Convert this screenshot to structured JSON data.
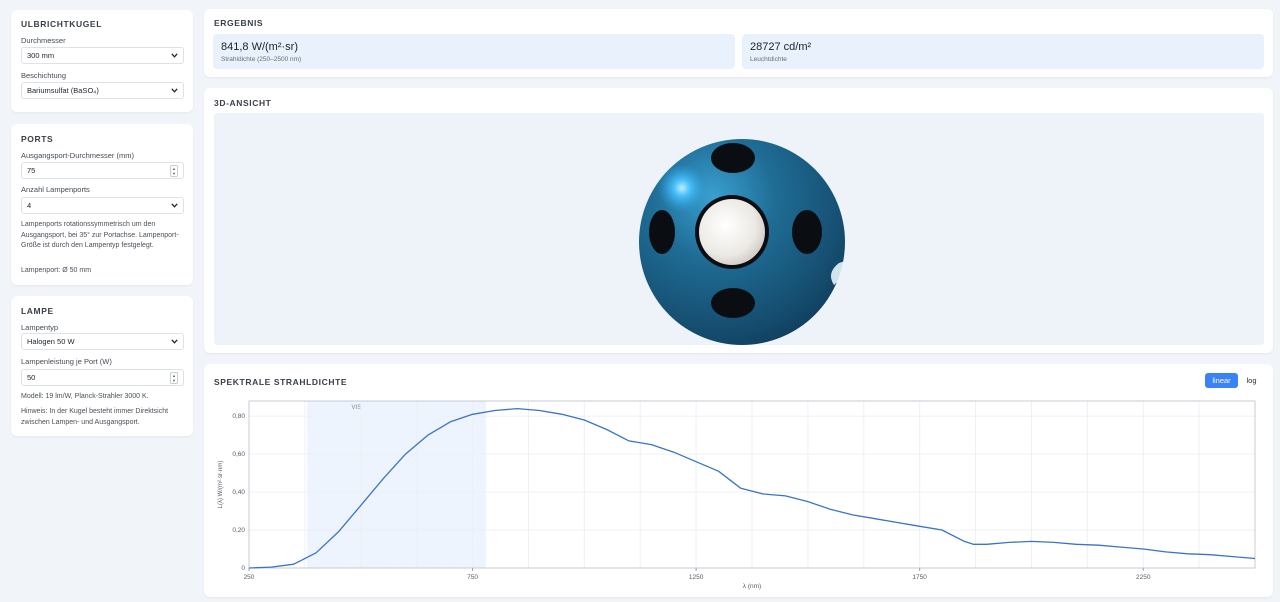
{
  "sphere_panel": {
    "title": "ULBRICHTKUGEL",
    "diameter_label": "Durchmesser",
    "diameter_value": "300 mm",
    "coating_label": "Beschichtung",
    "coating_value": "Bariumsulfat (BaSO₄)"
  },
  "ports_panel": {
    "title": "PORTS",
    "exit_port_label": "Ausgangsport-Durchmesser (mm)",
    "exit_port_value": "75",
    "lamp_count_label": "Anzahl Lampenports",
    "lamp_count_value": "4",
    "note": "Lampenports rotationssymmetrisch um den Ausgangsport, bei 35° zur Portachse. Lampenport-Größe ist durch den Lampentyp festgelegt.",
    "lamp_port_info": "Lampenport: Ø 50 mm"
  },
  "lamp_panel": {
    "title": "LAMPE",
    "type_label": "Lampentyp",
    "type_value": "Halogen 50 W",
    "power_label": "Lampenleistung je Port (W)",
    "power_value": "50",
    "model_note": "Modell: 19 lm/W, Planck-Strahler 3000 K.",
    "hint": "Hinweis: In der Kugel besteht immer Direktsicht zwischen Lampen- und Ausgangsport."
  },
  "result_panel": {
    "title": "ERGEBNIS",
    "radiance_value": "841,8 W/(m²·sr)",
    "radiance_label": "Strahldichte (250–2500 nm)",
    "luminance_value": "28727 cd/m²",
    "luminance_label": "Leuchtdichte"
  },
  "view_panel": {
    "title": "3D-ANSICHT"
  },
  "spectrum_panel": {
    "title": "SPEKTRALE STRAHLDICHTE",
    "linear_label": "linear",
    "log_label": "log"
  },
  "colors": {
    "accent": "#3b82f6",
    "sphere": "#1e5f86",
    "curve": "#3a74c4",
    "vis_band": "#eef4fd"
  },
  "chart_data": {
    "type": "line",
    "xlabel": "λ (nm)",
    "ylabel": "L(λ) W/(m²·sr·nm)",
    "xlim": [
      250,
      2500
    ],
    "ylim": [
      0,
      0.88
    ],
    "xticks": [
      250,
      750,
      1250,
      1750,
      2250
    ],
    "xtick_labels": [
      "250",
      "750",
      "1250",
      "1750",
      "2250"
    ],
    "yticks": [
      0,
      0.2,
      0.4,
      0.6,
      0.8
    ],
    "ytick_labels": [
      "0",
      "0,20",
      "0,40",
      "0,60",
      "0,80"
    ],
    "band": {
      "label": "VIS",
      "from": 380,
      "to": 780
    },
    "grid": true,
    "series": [
      {
        "x": [
          250,
          300,
          350,
          400,
          450,
          500,
          550,
          600,
          650,
          700,
          750,
          800,
          850,
          900,
          950,
          1000,
          1050,
          1100,
          1150,
          1200,
          1250,
          1300,
          1350,
          1400,
          1450,
          1500,
          1550,
          1600,
          1650,
          1700,
          1750,
          1800,
          1850,
          1870,
          1900,
          1950,
          2000,
          2050,
          2100,
          2150,
          2200,
          2250,
          2300,
          2350,
          2400,
          2450,
          2500
        ],
        "y": [
          0.0,
          0.005,
          0.02,
          0.08,
          0.19,
          0.33,
          0.47,
          0.6,
          0.7,
          0.77,
          0.81,
          0.83,
          0.84,
          0.83,
          0.81,
          0.78,
          0.73,
          0.67,
          0.65,
          0.61,
          0.56,
          0.51,
          0.42,
          0.39,
          0.38,
          0.35,
          0.31,
          0.28,
          0.26,
          0.24,
          0.22,
          0.2,
          0.14,
          0.125,
          0.125,
          0.135,
          0.14,
          0.135,
          0.125,
          0.12,
          0.11,
          0.1,
          0.085,
          0.075,
          0.07,
          0.06,
          0.05
        ]
      }
    ]
  }
}
